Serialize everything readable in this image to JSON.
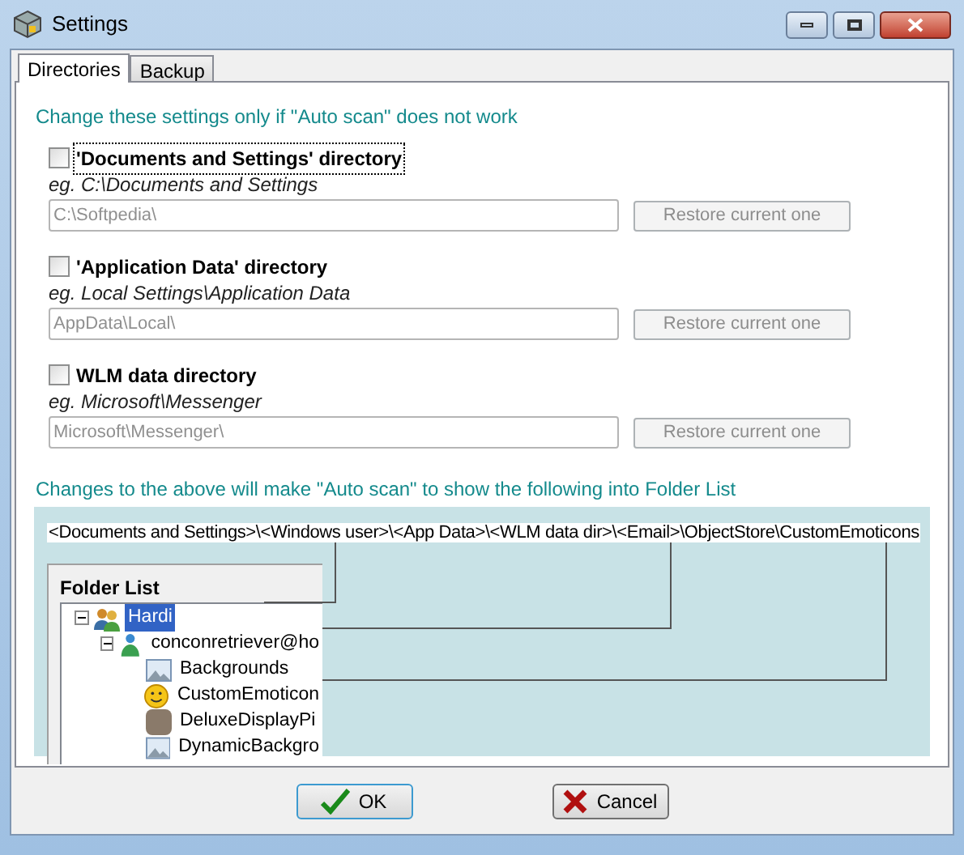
{
  "window": {
    "title": "Settings"
  },
  "tabs": [
    {
      "label": "Directories",
      "selected": true
    },
    {
      "label": "Backup",
      "selected": false
    }
  ],
  "intro": "Change these settings only if \"Auto scan\" does not work",
  "directories": [
    {
      "label": "'Documents and Settings' directory",
      "checked": false,
      "focused": true,
      "example": "eg. C:\\Documents and Settings",
      "value": "C:\\Softpedia\\",
      "button": "Restore current one"
    },
    {
      "label": "'Application Data' directory",
      "checked": false,
      "focused": false,
      "example": "eg. Local Settings\\Application Data",
      "value": "AppData\\Local\\",
      "button": "Restore current one"
    },
    {
      "label": "WLM data directory",
      "checked": false,
      "focused": false,
      "example": "eg. Microsoft\\Messenger",
      "value": "Microsoft\\Messenger\\",
      "button": "Restore current one"
    }
  ],
  "note": "Changes to the above will make \"Auto scan\" to show the following into Folder List",
  "diagram": {
    "path": "<Documents and Settings>\\<Windows user>\\<App Data>\\<WLM data dir>\\<Email>\\ObjectStore\\CustomEmoticons",
    "folder_list": {
      "title": "Folder List",
      "items": [
        {
          "label": "Hardi",
          "kind": "group",
          "selected": true,
          "expanded": true,
          "children": [
            {
              "label": "conconretriever@ho",
              "kind": "user",
              "selected": false,
              "expanded": true,
              "children": [
                {
                  "label": "Backgrounds",
                  "kind": "image",
                  "selected": false
                },
                {
                  "label": "CustomEmoticon",
                  "kind": "smiley",
                  "selected": false
                },
                {
                  "label": "DeluxeDisplayPi",
                  "kind": "photo",
                  "selected": false
                },
                {
                  "label": "DynamicBackgro",
                  "kind": "image",
                  "selected": false
                }
              ]
            }
          ]
        }
      ]
    }
  },
  "buttons": [
    {
      "label": "OK",
      "kind": "ok"
    },
    {
      "label": "Cancel",
      "kind": "cancel"
    }
  ]
}
